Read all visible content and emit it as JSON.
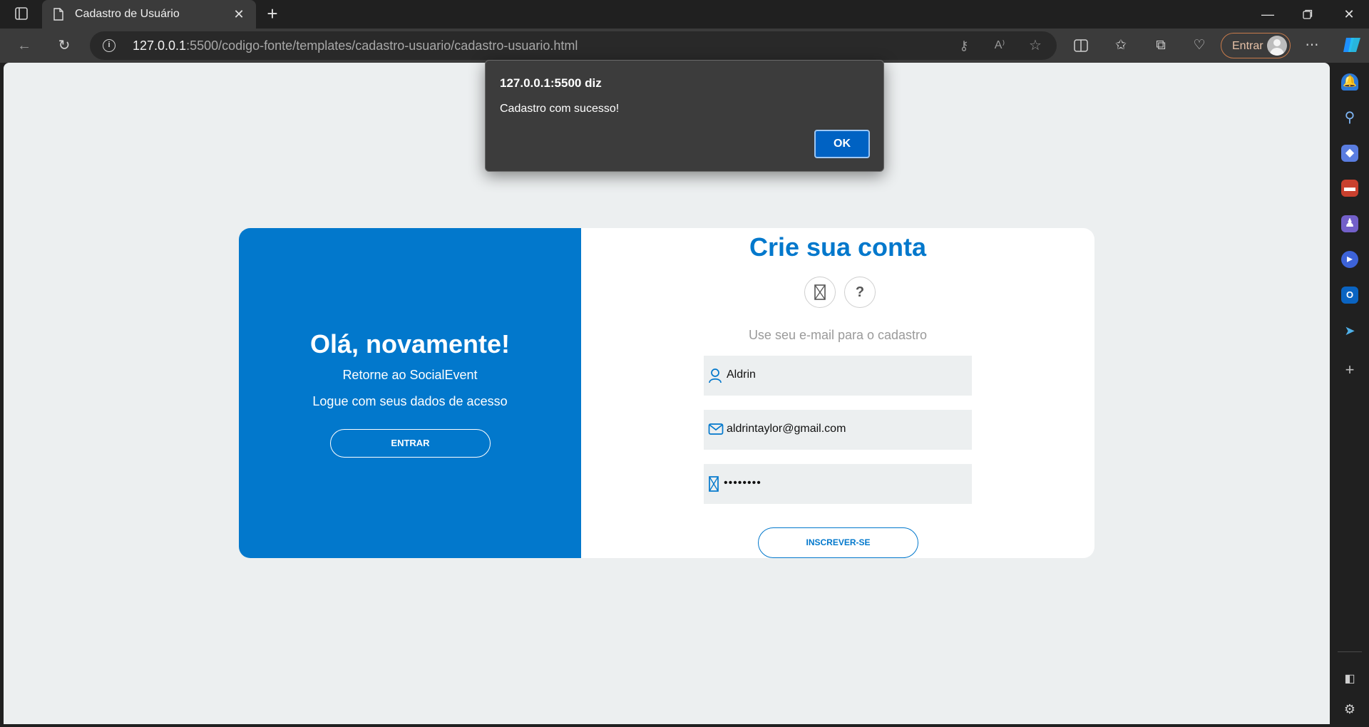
{
  "browser": {
    "tab_title": "Cadastro de Usuário",
    "url_host": "127.0.0.1",
    "url_rest": ":5500/codigo-fonte/templates/cadastro-usuario/cadastro-usuario.html",
    "signin_label": "Entrar"
  },
  "dialog": {
    "title": "127.0.0.1:5500 diz",
    "message": "Cadastro com sucesso!",
    "ok_label": "OK"
  },
  "left_panel": {
    "heading": "Olá, novamente!",
    "line1": "Retorne ao SocialEvent",
    "line2": "Logue com seus dados de acesso",
    "button": "ENTRAR"
  },
  "right_panel": {
    "heading": "Crie sua conta",
    "social_icons": [
      "missing-glyph-icon",
      "help-icon"
    ],
    "subtitle": "Use seu e-mail para o cadastro",
    "fields": {
      "name": "Aldrin",
      "email": "aldrintaylor@gmail.com",
      "password": "••••••••"
    },
    "button": "INSCREVER-SE"
  },
  "colors": {
    "accent": "#0278cc",
    "page_bg": "#eceff0",
    "dialog_bg": "#3c3c3c",
    "ok_button": "#0062c3"
  }
}
